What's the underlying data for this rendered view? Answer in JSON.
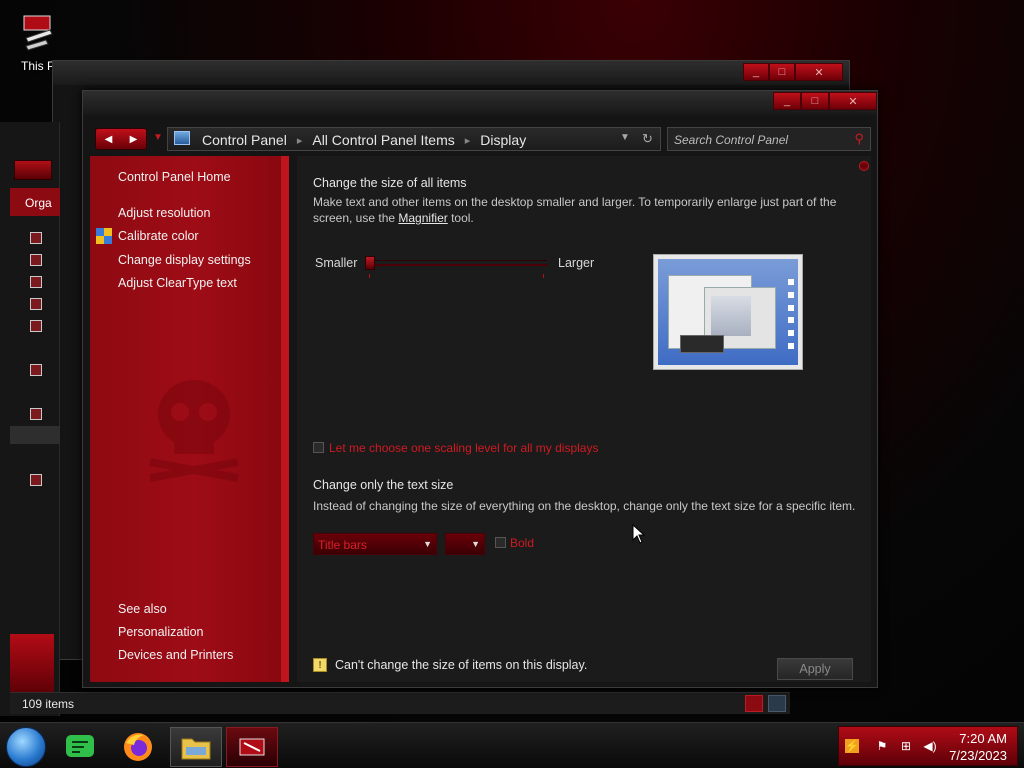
{
  "desktop": {
    "icon_label": "This P"
  },
  "explorer_bg": {
    "organize_label": "Orga",
    "status_items": "109 items"
  },
  "window": {
    "nav": {
      "back_icon": "back-arrow-icon",
      "forward_icon": "forward-arrow-icon"
    },
    "breadcrumb": [
      "Control Panel",
      "All Control Panel Items",
      "Display"
    ],
    "search": {
      "placeholder": "Search Control Panel"
    },
    "sidebar": {
      "home": "Control Panel Home",
      "links": [
        "Adjust resolution",
        "Calibrate color",
        "Change display settings",
        "Adjust ClearType text"
      ],
      "see_also_title": "See also",
      "see_also": [
        "Personalization",
        "Devices and Printers"
      ]
    },
    "main": {
      "size_heading": "Change the size of all items",
      "size_desc_before": "Make text and other items on the desktop smaller and larger. To temporarily enlarge just part of the screen, use the ",
      "magnifier_link": "Magnifier",
      "size_desc_after": " tool.",
      "slider": {
        "min_label": "Smaller",
        "max_label": "Larger",
        "position": 0
      },
      "scaling_checkbox": "Let me choose one scaling level for all my displays",
      "text_heading": "Change only the text size",
      "text_desc": "Instead of changing the size of everything on the desktop, change only the text size for a specific item.",
      "item_select": "Title bars",
      "size_select": "",
      "bold_label": "Bold",
      "warning": "Can't change the size of items on this display.",
      "apply_label": "Apply"
    }
  },
  "taskbar": {
    "apps": [
      "windows-orb-icon",
      "messaging-app-icon",
      "firefox-icon",
      "file-explorer-icon",
      "control-panel-icon"
    ],
    "clock_time": "7:20 AM",
    "clock_date": "7/23/2023"
  },
  "colors": {
    "accent_red": "#c0141e",
    "sidebar_red": "#9e0c16",
    "content_bg": "#1b1b1b",
    "warning_red_text": "#d01a22"
  }
}
